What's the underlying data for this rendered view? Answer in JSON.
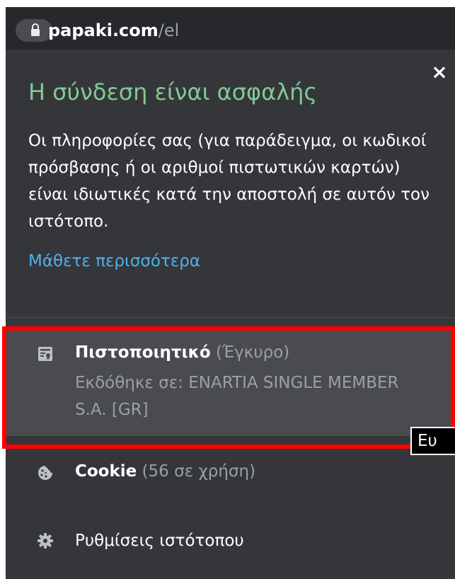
{
  "address_bar": {
    "host": "papaki.com",
    "path": "/el",
    "lock_icon": "lock-icon"
  },
  "popup": {
    "close_label": "×",
    "title": "Η σύνδεση είναι ασφαλής",
    "description": "Οι πληροφορίες σας (για παράδειγμα, οι κωδικοί πρόσβασης ή οι αριθμοί πιστωτικών καρτών) είναι ιδιωτικές κατά την αποστολή σε αυτόν τον ιστότοπο.",
    "learn_more": "Μάθετε περισσότερα",
    "certificate": {
      "icon": "certificate-icon",
      "label": "Πιστοποιητικό",
      "status": "(Έγκυρο)",
      "issued_by": "Εκδόθηκε σε: ENARTIA SINGLE MEMBER S.A. [GR]"
    },
    "cookies": {
      "icon": "cookie-icon",
      "label": "Cookie",
      "count": "(56 σε χρήση)"
    },
    "site_settings": {
      "icon": "gear-icon",
      "label": "Ρυθμίσεις ιστότοπου"
    }
  },
  "tooltip": {
    "text": "Ευ"
  },
  "colors": {
    "popup_bg": "#35363a",
    "secure_green": "#81c995",
    "link_blue": "#4fb3e8",
    "highlight_red": "#ff0000"
  }
}
